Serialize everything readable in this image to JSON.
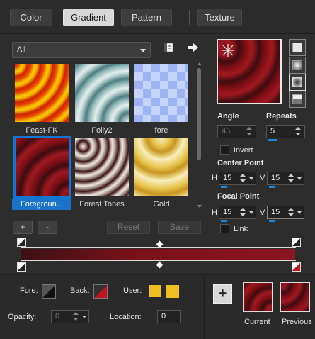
{
  "tabs": [
    {
      "label": "Color"
    },
    {
      "label": "Gradient"
    },
    {
      "label": "Pattern"
    },
    {
      "label": "Texture"
    }
  ],
  "active_tab": "Gradient",
  "filter": {
    "selected": "All"
  },
  "gallery": {
    "items": [
      {
        "label": "Feast-FK"
      },
      {
        "label": "Folly2"
      },
      {
        "label": "fore"
      },
      {
        "label": "Foregroun..."
      },
      {
        "label": "Forest Tones"
      },
      {
        "label": "Gold"
      }
    ],
    "selected": "Foregroun..."
  },
  "buttons": {
    "add": "+",
    "remove": "-",
    "reset": "Reset",
    "save": "Save"
  },
  "settings": {
    "angle": {
      "label": "Angle",
      "value": "45"
    },
    "repeats": {
      "label": "Repeats",
      "value": "5"
    },
    "invert": {
      "label": "Invert",
      "checked": false
    },
    "center_point": {
      "label": "Center Point",
      "h_label": "H",
      "h": "15",
      "v_label": "V",
      "v": "15"
    },
    "focal_point": {
      "label": "Focal Point",
      "h_label": "H",
      "h": "15",
      "v_label": "V",
      "v": "15"
    },
    "link": {
      "label": "Link",
      "checked": false
    }
  },
  "colors": {
    "fore_label": "Fore:",
    "back_label": "Back:",
    "user_label": "User:",
    "user1": "#f0c020",
    "user2": "#f0c020",
    "gradient_dark": "#3a1116",
    "gradient_red": "#8b1520",
    "accent": "#1a73c8"
  },
  "opacity": {
    "label": "Opacity:",
    "value": "0"
  },
  "location": {
    "label": "Location:",
    "value": "0"
  },
  "previews": {
    "current": "Current",
    "previous": "Previous"
  },
  "icons": [
    "notebook-icon",
    "arrow-right-icon",
    "star-icon",
    "plus-icon"
  ]
}
